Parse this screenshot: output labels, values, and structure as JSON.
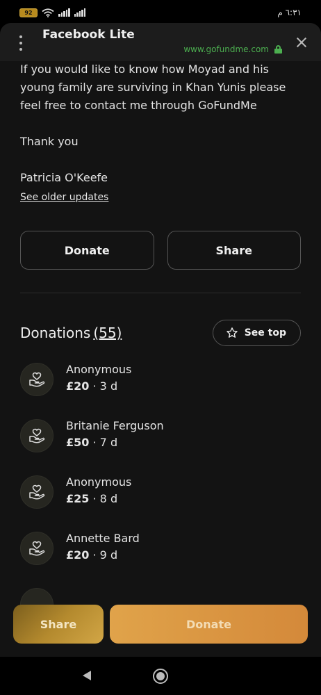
{
  "status_bar": {
    "battery": "92",
    "time": "٦:٣١ م"
  },
  "browser": {
    "title": "Facebook Lite",
    "url": "www.gofundme.com"
  },
  "update": {
    "paragraph1": "If you would like to know how Moyad and his young family are surviving in Khan Yunis please feel free to contact me through GoFundMe",
    "paragraph2": "Thank you",
    "signature": "Patricia O'Keefe",
    "older_link": "See older updates"
  },
  "actions": {
    "donate_label": "Donate",
    "share_label": "Share"
  },
  "donations": {
    "title": "Donations",
    "count": "(55)",
    "see_top_label": "See top",
    "items": [
      {
        "name": "Anonymous",
        "amount": "£20",
        "time": "3 d"
      },
      {
        "name": "Britanie Ferguson",
        "amount": "£50",
        "time": "7 d"
      },
      {
        "name": "Anonymous",
        "amount": "£25",
        "time": "8 d"
      },
      {
        "name": "Annette Bard",
        "amount": "£20",
        "time": "9 d"
      }
    ]
  },
  "footer": {
    "share_label": "Share",
    "donate_label": "Donate"
  },
  "icons": {
    "donor": "hand-heart-icon",
    "star": "star-outline-icon",
    "lock": "lock-icon",
    "close": "close-icon",
    "menu": "kebab-menu-icon"
  },
  "colors": {
    "url_green": "#4caf50",
    "donate_orange": "#d99440",
    "share_gold": "#b48a2e"
  }
}
